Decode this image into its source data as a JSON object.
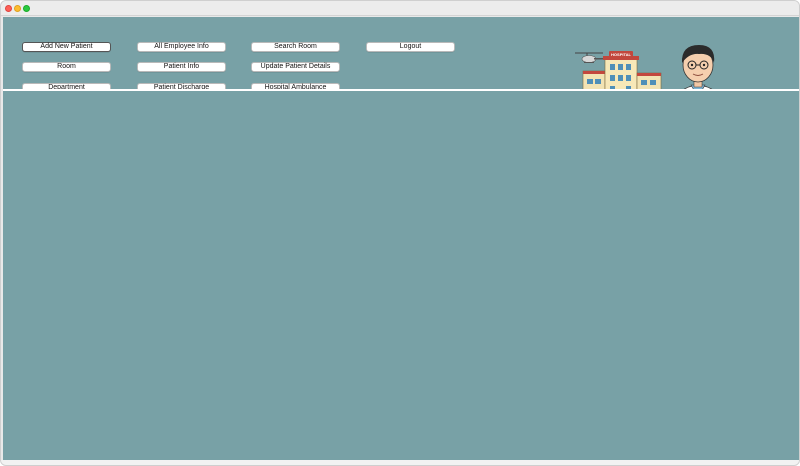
{
  "window": {
    "controls": [
      "close",
      "minimize",
      "maximize"
    ]
  },
  "toolbar": {
    "buttons": [
      {
        "label": "Add New Patient"
      },
      {
        "label": "All Employee Info"
      },
      {
        "label": "Search Room"
      },
      {
        "label": "Logout"
      },
      {
        "label": "Room"
      },
      {
        "label": "Patient Info"
      },
      {
        "label": "Update Patient Details"
      },
      {
        "label": "Department"
      },
      {
        "label": "Patient Discharge"
      },
      {
        "label": "Hospital Ambulance"
      }
    ]
  },
  "illustration": {
    "hospital_sign": "HOSPITAL",
    "icons": [
      "hospital-building-icon",
      "helicopter-icon",
      "doctor-avatar-icon"
    ]
  },
  "colors": {
    "panel": "#78a1a6",
    "divider": "#ffffff",
    "button_bg": "#ffffff"
  }
}
